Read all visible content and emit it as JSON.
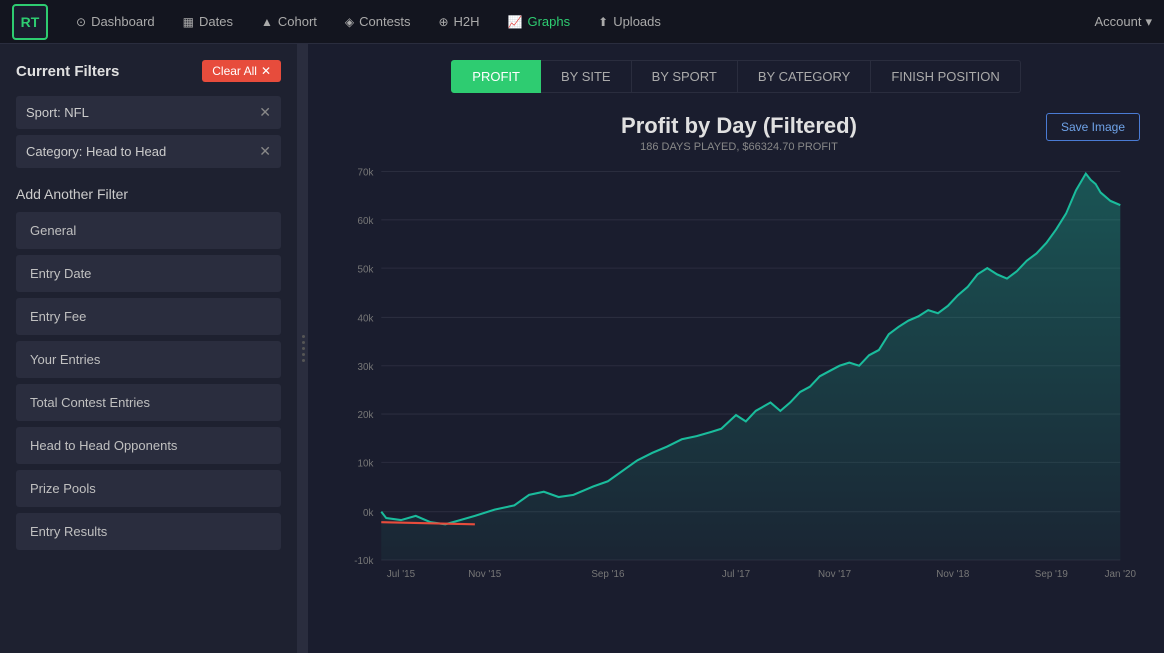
{
  "navbar": {
    "logo": "RT",
    "items": [
      {
        "id": "dashboard",
        "label": "Dashboard",
        "icon": "⊙"
      },
      {
        "id": "dates",
        "label": "Dates",
        "icon": "▦"
      },
      {
        "id": "cohort",
        "label": "Cohort",
        "icon": "▲"
      },
      {
        "id": "contests",
        "label": "Contests",
        "icon": "◈"
      },
      {
        "id": "h2h",
        "label": "H2H",
        "icon": "⊕"
      },
      {
        "id": "graphs",
        "label": "Graphs",
        "icon": "📈",
        "active": true
      },
      {
        "id": "uploads",
        "label": "Uploads",
        "icon": "⬆"
      }
    ],
    "account_label": "Account"
  },
  "sidebar": {
    "title": "Current Filters",
    "clear_all_label": "Clear All",
    "active_filters": [
      {
        "id": "sport-nfl",
        "label": "Sport: NFL"
      },
      {
        "id": "category-h2h",
        "label": "Category: Head to Head"
      }
    ],
    "add_filter_title": "Add Another Filter",
    "filter_buttons": [
      {
        "id": "general",
        "label": "General"
      },
      {
        "id": "entry-date",
        "label": "Entry Date"
      },
      {
        "id": "entry-fee",
        "label": "Entry Fee"
      },
      {
        "id": "your-entries",
        "label": "Your Entries"
      },
      {
        "id": "total-contest-entries",
        "label": "Total Contest Entries"
      },
      {
        "id": "head-to-head-opponents",
        "label": "Head to Head Opponents"
      },
      {
        "id": "prize-pools",
        "label": "Prize Pools"
      },
      {
        "id": "entry-results",
        "label": "Entry Results"
      }
    ]
  },
  "tabs": [
    {
      "id": "profit",
      "label": "PROFIT",
      "active": true
    },
    {
      "id": "by-site",
      "label": "BY SITE"
    },
    {
      "id": "by-sport",
      "label": "BY SPORT"
    },
    {
      "id": "by-category",
      "label": "BY CATEGORY"
    },
    {
      "id": "finish-position",
      "label": "FINISH POSITION"
    }
  ],
  "chart": {
    "title": "Profit by Day (Filtered)",
    "subtitle": "186 DAYS PLAYED, $66324.70 PROFIT",
    "save_image_label": "Save Image",
    "y_labels": [
      "70k",
      "60k",
      "50k",
      "40k",
      "30k",
      "20k",
      "10k",
      "0k",
      "-10k"
    ],
    "x_labels": [
      "Jul '15",
      "Nov '15",
      "Sep '16",
      "Jul '17",
      "Nov '17",
      "Nov '18",
      "Sep '19",
      "Jan '20"
    ]
  },
  "colors": {
    "active_nav": "#2ecc71",
    "tab_active_bg": "#2ecc71",
    "chart_line": "#1abc9c",
    "chart_start_line": "#e74c3c",
    "clear_all_bg": "#e74c3c",
    "accent_blue": "#4a7bd4"
  }
}
